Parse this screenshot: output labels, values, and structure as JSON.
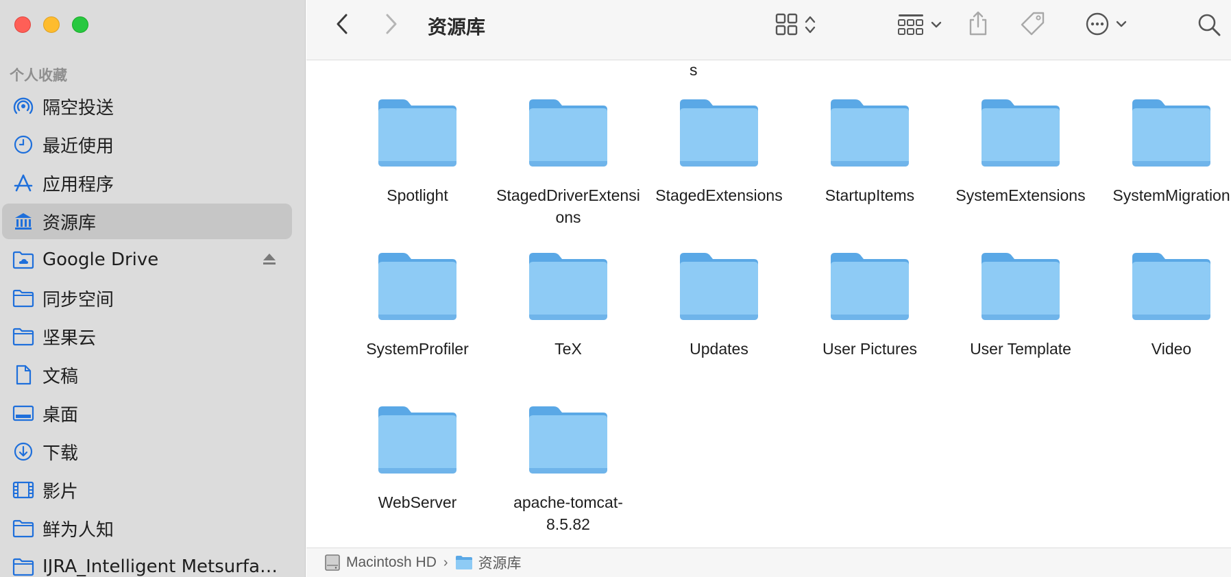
{
  "window": {
    "title": "资源库"
  },
  "sidebar": {
    "section_title": "个人收藏",
    "items": [
      {
        "label": "隔空投送",
        "icon": "airdrop-icon"
      },
      {
        "label": "最近使用",
        "icon": "clock-icon"
      },
      {
        "label": "应用程序",
        "icon": "applications-icon"
      },
      {
        "label": "资源库",
        "icon": "library-icon",
        "selected": true
      },
      {
        "label": "Google Drive",
        "icon": "cloud-folder-icon",
        "ejectable": true
      },
      {
        "label": "同步空间",
        "icon": "folder-icon"
      },
      {
        "label": "坚果云",
        "icon": "folder-icon"
      },
      {
        "label": "文稿",
        "icon": "document-icon"
      },
      {
        "label": "桌面",
        "icon": "desktop-icon"
      },
      {
        "label": "下载",
        "icon": "download-icon"
      },
      {
        "label": "影片",
        "icon": "film-icon"
      },
      {
        "label": "鲜为人知",
        "icon": "folder-icon"
      },
      {
        "label": "IJRA_Intelligent Metsurfac...",
        "icon": "folder-icon"
      }
    ]
  },
  "content": {
    "truncated_label": "s",
    "folders": [
      {
        "name": "Spotlight"
      },
      {
        "name": "StagedDriverExtensions"
      },
      {
        "name": "StagedExtensions"
      },
      {
        "name": "StartupItems"
      },
      {
        "name": "SystemExtensions"
      },
      {
        "name": "SystemMigration"
      },
      {
        "name": "SystemProfiler"
      },
      {
        "name": "TeX"
      },
      {
        "name": "Updates"
      },
      {
        "name": "User Pictures"
      },
      {
        "name": "User Template"
      },
      {
        "name": "Video"
      },
      {
        "name": "WebServer"
      },
      {
        "name": "apache-tomcat-8.5.82"
      }
    ]
  },
  "pathbar": {
    "segments": [
      {
        "label": "Macintosh HD",
        "icon": "hard-drive-icon"
      },
      {
        "label": "资源库",
        "icon": "folder-icon"
      }
    ],
    "separator": "›"
  },
  "colors": {
    "accent": "#1e6fdb",
    "folder_body": "#8ecbf5",
    "folder_tab": "#5aa8e6",
    "sidebar_bg": "#dcdcdc",
    "selected_bg": "#c6c6c6"
  }
}
